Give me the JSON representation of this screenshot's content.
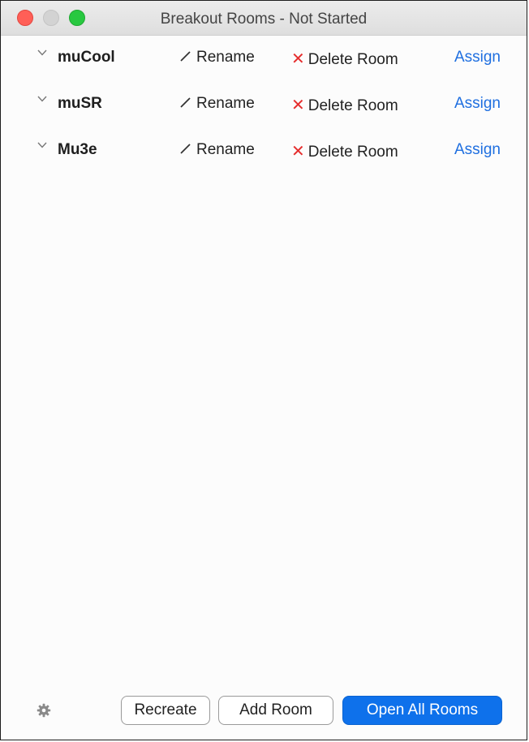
{
  "window": {
    "title": "Breakout Rooms - Not Started"
  },
  "rooms": [
    {
      "name": "muCool",
      "rename_label": "Rename",
      "delete_label": "Delete Room",
      "assign_label": "Assign"
    },
    {
      "name": "muSR",
      "rename_label": "Rename",
      "delete_label": "Delete Room",
      "assign_label": "Assign"
    },
    {
      "name": "Mu3e",
      "rename_label": "Rename",
      "delete_label": "Delete Room",
      "assign_label": "Assign"
    }
  ],
  "footer": {
    "recreate_label": "Recreate",
    "add_room_label": "Add Room",
    "open_all_label": "Open All Rooms"
  },
  "icons": {
    "settings": "gear-icon",
    "rename": "pencil-icon",
    "delete": "x-icon",
    "expand": "chevron-down-icon"
  },
  "colors": {
    "primary_button": "#0e71eb",
    "link": "#1f6fe0",
    "delete_x": "#e52d2d",
    "close_button": "#ff5f57",
    "zoom_button": "#28c840"
  }
}
